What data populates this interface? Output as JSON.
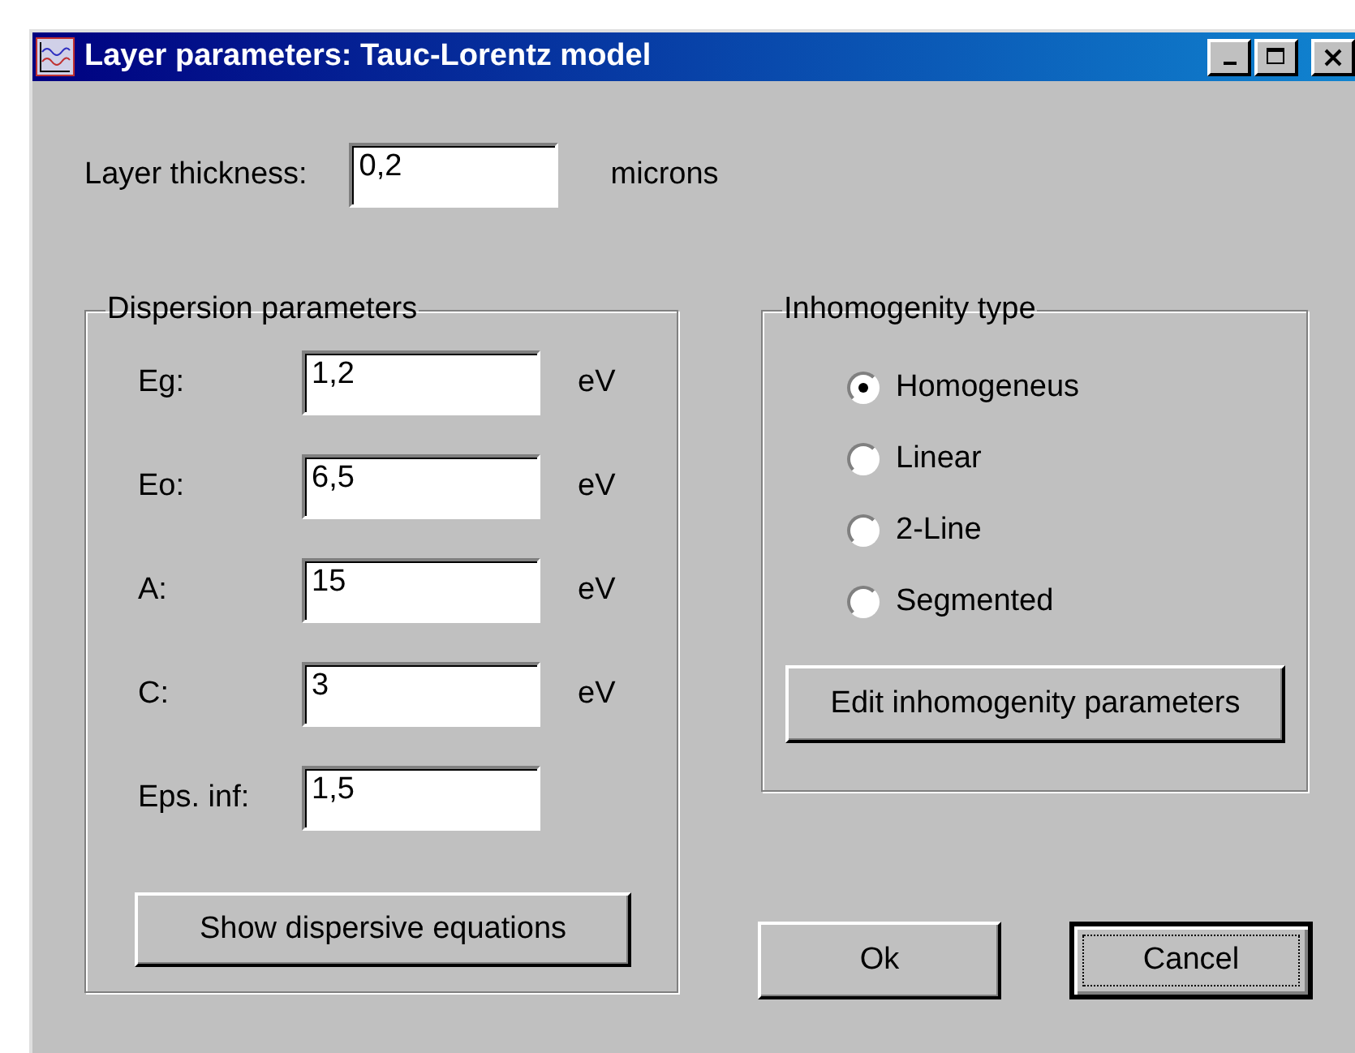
{
  "window": {
    "title": "Layer parameters: Tauc-Lorentz model"
  },
  "thickness": {
    "label": "Layer thickness:",
    "value": "0,2",
    "unit": "microns"
  },
  "dispersion": {
    "title": "Dispersion parameters",
    "fields": [
      {
        "label": "Eg:",
        "value": "1,2",
        "unit": "eV"
      },
      {
        "label": "Eo:",
        "value": "6,5",
        "unit": "eV"
      },
      {
        "label": "A:",
        "value": "15",
        "unit": "eV"
      },
      {
        "label": "C:",
        "value": "3",
        "unit": "eV"
      },
      {
        "label": "Eps. inf:",
        "value": "1,5"
      }
    ],
    "button": "Show dispersive equations"
  },
  "inhomogeneity": {
    "title": "Inhomogenity type",
    "options": [
      {
        "label": "Homogeneus",
        "selected": true
      },
      {
        "label": "Linear",
        "selected": false
      },
      {
        "label": "2-Line",
        "selected": false
      },
      {
        "label": "Segmented",
        "selected": false
      }
    ],
    "button": "Edit inhomogenity parameters"
  },
  "buttons": [
    {
      "label": "Ok",
      "focused": false
    },
    {
      "label": "Cancel",
      "focused": true
    }
  ]
}
